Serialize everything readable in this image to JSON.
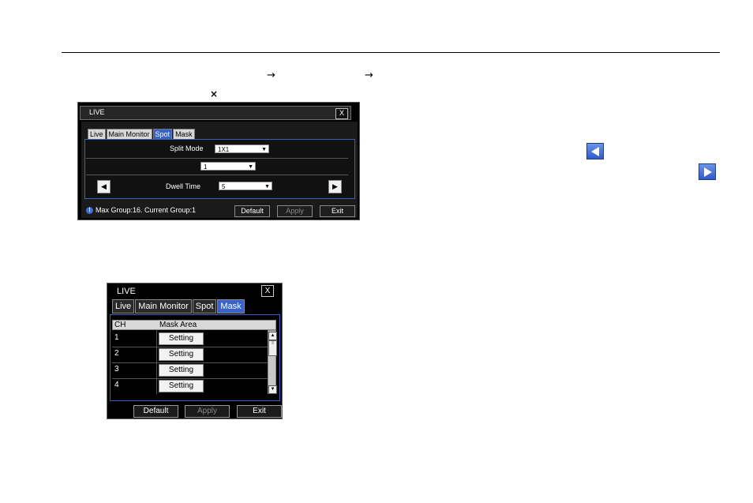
{
  "glyphs": {
    "arrow": "→",
    "times": "×"
  },
  "spot_dialog": {
    "title": "LIVE",
    "close": "X",
    "tabs": [
      {
        "label": "Live",
        "selected": false
      },
      {
        "label": "Main Monitor",
        "selected": false
      },
      {
        "label": "Spot",
        "selected": true
      },
      {
        "label": "Mask",
        "selected": false
      }
    ],
    "split_mode_label": "Split Mode",
    "split_mode_value": "1X1",
    "group_value": "1",
    "dwell_time_label": "Dwell Time",
    "dwell_time_value": "5",
    "status_text": "Max Group:16.  Current Group:1",
    "buttons": {
      "default": "Default",
      "apply": "Apply",
      "exit": "Exit"
    }
  },
  "mask_dialog": {
    "title": "LIVE",
    "close": "X",
    "tabs": [
      {
        "label": "Live",
        "selected": false
      },
      {
        "label": "Main Monitor",
        "selected": false
      },
      {
        "label": "Spot",
        "selected": false
      },
      {
        "label": "Mask",
        "selected": true
      }
    ],
    "columns": [
      "CH",
      "Mask Area"
    ],
    "rows": [
      {
        "ch": "1",
        "action": "Setting"
      },
      {
        "ch": "2",
        "action": "Setting"
      },
      {
        "ch": "3",
        "action": "Setting"
      },
      {
        "ch": "4",
        "action": "Setting"
      }
    ],
    "buttons": {
      "default": "Default",
      "apply": "Apply",
      "exit": "Exit"
    }
  },
  "colors": {
    "accent_blue": "#3a63c8",
    "dialog_bg": "#000000"
  },
  "icons": [
    "left-arrow-icon",
    "right-arrow-icon"
  ]
}
